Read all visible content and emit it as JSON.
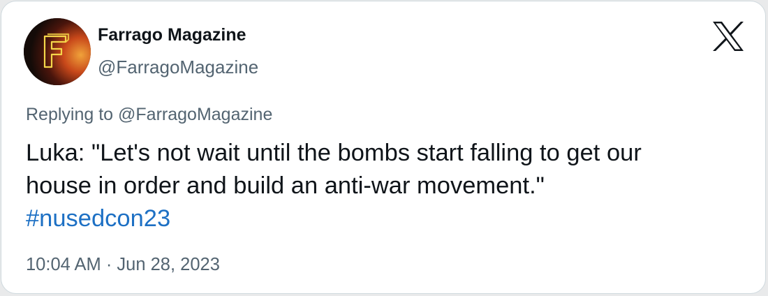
{
  "author": {
    "display_name": "Farrago Magazine",
    "handle": "@FarragoMagazine",
    "avatar_letter": "F",
    "avatar_icon": "farrago-logo-icon"
  },
  "platform_icon": "x-logo-icon",
  "tweet": {
    "reply_prefix": "Replying to ",
    "reply_handle": "@FarragoMagazine",
    "text_lines": [
      "Luka: \"Let's not wait until the bombs start falling to get our",
      "house in order and build an anti-war movement.\""
    ],
    "hashtag": "#nusedcon23",
    "time": "10:04 AM",
    "separator": " · ",
    "date": "Jun 28, 2023"
  },
  "colors": {
    "text_primary": "#0f1419",
    "text_secondary": "#536471",
    "link": "#1d70c4",
    "border": "#cfd9de"
  }
}
